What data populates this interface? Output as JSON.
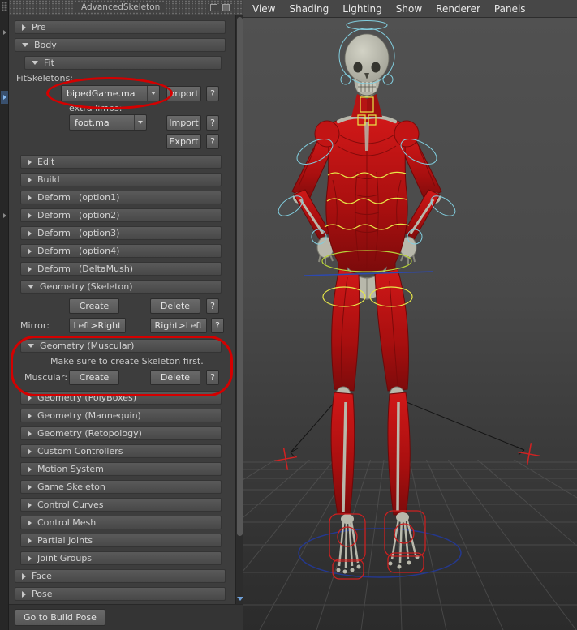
{
  "panel": {
    "title": "AdvancedSkeleton",
    "sections": {
      "pre": "Pre",
      "body": "Body",
      "fit": "Fit",
      "edit": "Edit",
      "build": "Build",
      "deform1": {
        "label": "Deform",
        "option": "(option1)"
      },
      "deform2": {
        "label": "Deform",
        "option": "(option2)"
      },
      "deform3": {
        "label": "Deform",
        "option": "(option3)"
      },
      "deform4": {
        "label": "Deform",
        "option": "(option4)"
      },
      "deform_dm": {
        "label": "Deform",
        "option": "(DeltaMush)"
      },
      "geo_skeleton": "Geometry (Skeleton)",
      "geo_muscular": "Geometry (Muscular)",
      "geo_polyboxes": "Geometry (PolyBoxes)",
      "geo_mannequin": "Geometry (Mannequin)",
      "geo_retopology": "Geometry (Retopology)",
      "custom_controllers": "Custom Controllers",
      "motion_system": "Motion System",
      "game_skeleton": "Game Skeleton",
      "control_curves": "Control Curves",
      "control_mesh": "Control Mesh",
      "partial_joints": "Partial Joints",
      "joint_groups": "Joint Groups",
      "face": "Face",
      "pose": "Pose"
    },
    "fit": {
      "fitskeletons_label": "FitSkeletons:",
      "skeleton_file": "bipedGame.ma",
      "import_label": "Import",
      "help_label": "?",
      "extra_limbs_label": "extra limbs:",
      "limbs_file": "foot.ma",
      "export_label": "Export"
    },
    "geo_skeleton": {
      "create_label": "Create",
      "delete_label": "Delete",
      "mirror_label": "Mirror:",
      "left_right_label": "Left>Right",
      "right_left_label": "Right>Left"
    },
    "geo_muscular": {
      "note": "Make sure to create Skeleton first.",
      "muscular_label": "Muscular:",
      "create_label": "Create",
      "delete_label": "Delete"
    },
    "go_to_build_pose": "Go to Build Pose"
  },
  "viewport": {
    "menu": [
      "View",
      "Shading",
      "Lighting",
      "Show",
      "Renderer",
      "Panels"
    ]
  },
  "colors": {
    "annotation_red": "#d40000",
    "muscle_red": "#c01414",
    "bone_gray": "#b8b8ab",
    "control_cyan": "#82cfe0",
    "control_yellow": "#e8e848",
    "control_green": "#b7d23a",
    "control_blue": "#2d49b0",
    "foot_control_red": "#cc2020"
  }
}
